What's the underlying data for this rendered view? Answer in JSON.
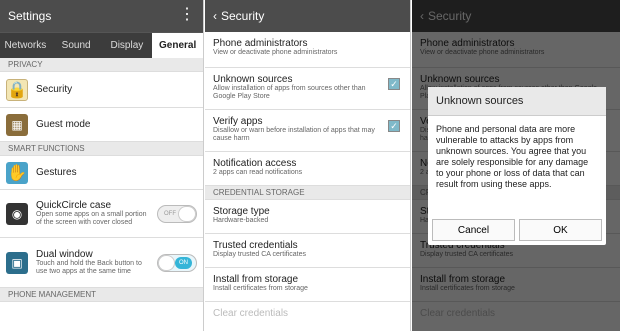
{
  "settings": {
    "title": "Settings",
    "menu_icon": "more-vert-icon",
    "tabs": [
      "Networks",
      "Sound",
      "Display",
      "General"
    ],
    "sections": {
      "privacy": "PRIVACY",
      "smart": "SMART FUNCTIONS",
      "phone": "PHONE MANAGEMENT"
    },
    "items": {
      "security": "Security",
      "guest": "Guest mode",
      "gestures": "Gestures",
      "quickcircle_title": "QuickCircle case",
      "quickcircle_sub": "Open some apps on a small portion of the screen with cover closed",
      "dual_title": "Dual window",
      "dual_sub": "Touch and hold the Back button to use two apps at the same time"
    },
    "toggle": {
      "off": "OFF",
      "on": "ON"
    }
  },
  "security": {
    "title": "Security",
    "items": [
      {
        "title": "Phone administrators",
        "sub": "View or deactivate phone administrators"
      },
      {
        "title": "Unknown sources",
        "sub": "Allow installation of apps from sources other than Google Play Store"
      },
      {
        "title": "Verify apps",
        "sub": "Disallow or warn before installation of apps that may cause harm"
      },
      {
        "title": "Notification access",
        "sub": "2 apps can read notifications"
      }
    ],
    "section": "CREDENTIAL STORAGE",
    "items2": [
      {
        "title": "Storage type",
        "sub": "Hardware-backed"
      },
      {
        "title": "Trusted credentials",
        "sub": "Display trusted CA certificates"
      },
      {
        "title": "Install from storage",
        "sub": "Install certificates from storage"
      },
      {
        "title": "Clear credentials",
        "sub": ""
      }
    ]
  },
  "dialog": {
    "title": "Unknown sources",
    "body": "Phone and personal data are more vulnerable to attacks by apps from unknown sources. You agree that you are solely responsible for any damage to your phone or loss of data that can result from using these apps.",
    "cancel": "Cancel",
    "ok": "OK"
  }
}
